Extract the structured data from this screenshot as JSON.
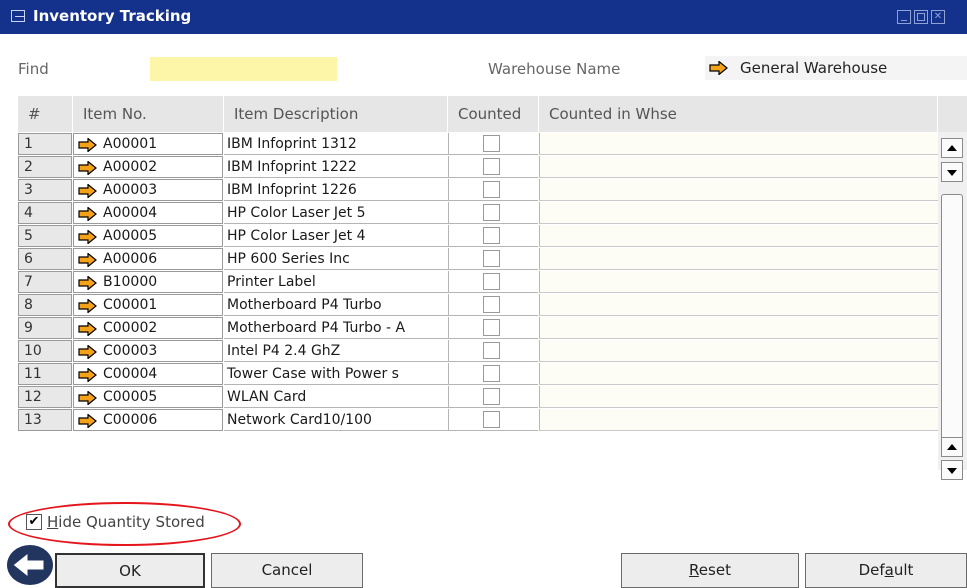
{
  "window": {
    "title": "Inventory Tracking"
  },
  "find": {
    "label": "Find",
    "value": ""
  },
  "warehouse": {
    "label": "Warehouse Name",
    "value": "General Warehouse"
  },
  "columns": {
    "num": "#",
    "item_no": "Item No.",
    "description": "Item Description",
    "counted": "Counted",
    "counted_in_whse": "Counted in Whse"
  },
  "rows": [
    {
      "num": "1",
      "item_no": "A00001",
      "description": "IBM Infoprint 1312",
      "counted": false
    },
    {
      "num": "2",
      "item_no": "A00002",
      "description": "IBM Infoprint 1222",
      "counted": false
    },
    {
      "num": "3",
      "item_no": "A00003",
      "description": "IBM Infoprint 1226",
      "counted": false
    },
    {
      "num": "4",
      "item_no": "A00004",
      "description": "HP Color Laser Jet 5",
      "counted": false
    },
    {
      "num": "5",
      "item_no": "A00005",
      "description": "HP Color Laser Jet 4",
      "counted": false
    },
    {
      "num": "6",
      "item_no": "A00006",
      "description": "HP 600 Series Inc",
      "counted": false
    },
    {
      "num": "7",
      "item_no": "B10000",
      "description": "Printer Label",
      "counted": false
    },
    {
      "num": "8",
      "item_no": "C00001",
      "description": "Motherboard P4 Turbo",
      "counted": false
    },
    {
      "num": "9",
      "item_no": "C00002",
      "description": "Motherboard P4 Turbo - A",
      "counted": false
    },
    {
      "num": "10",
      "item_no": "C00003",
      "description": "Intel P4 2.4 GhZ",
      "counted": false
    },
    {
      "num": "11",
      "item_no": "C00004",
      "description": "Tower Case with Power s",
      "counted": false
    },
    {
      "num": "12",
      "item_no": "C00005",
      "description": "WLAN Card",
      "counted": false
    },
    {
      "num": "13",
      "item_no": "C00006",
      "description": "Network Card10/100",
      "counted": false
    }
  ],
  "hide_quantity": {
    "label": "Hide Quantity Stored",
    "checked": true
  },
  "buttons": {
    "ok": "OK",
    "cancel": "Cancel",
    "reset": "Reset",
    "default": "Default"
  },
  "colors": {
    "titlebar": "#14328c",
    "find_highlight": "#fdf5a8",
    "link_arrow": "#f5a21b",
    "annotation": "#e4151b"
  },
  "icons": {
    "link_arrow": "orange-arrow-icon",
    "nav": "back-arrow-icon"
  }
}
